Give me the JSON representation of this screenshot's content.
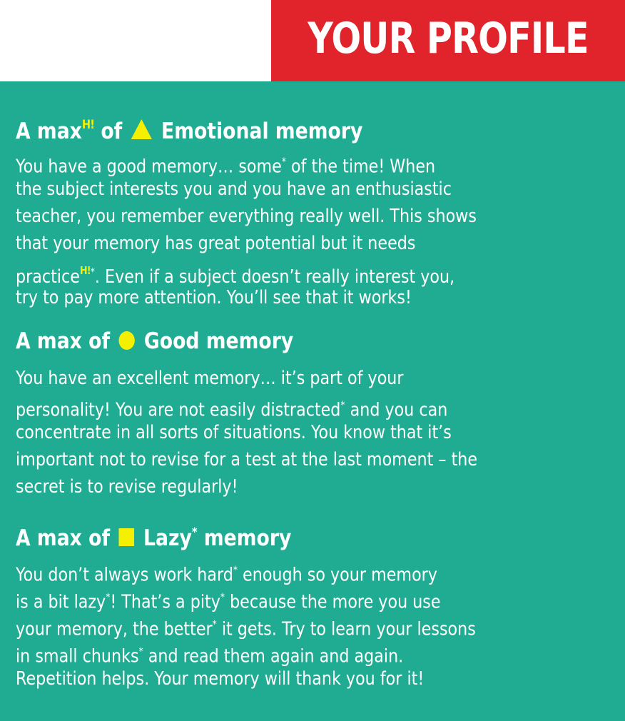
{
  "title": "YOUR PROFILE",
  "sections": [
    {
      "heading_prefix": "A max",
      "heading_sup": "H!",
      "heading_of": "of",
      "heading_text": "Emotional memory",
      "symbol": "triangle-icon",
      "body": {
        "line1": "You have a good memory… some",
        "line1_star": "*",
        "line1_end": " of the time! When",
        "line2": "the subject interests you and you have an enthusiastic",
        "line3": "teacher, you remember everything really well. This shows",
        "line4": "that your memory has great potential but it needs",
        "line5": "practice",
        "line5_sup": "H!",
        "line5_star": "*",
        "line5_end": ". Even if a subject doesn’t really interest you,",
        "line6": "try to pay more attention. You’ll see that it works!"
      }
    },
    {
      "heading_prefix": "A max of",
      "heading_text": "Good memory",
      "symbol": "circle-icon",
      "body": {
        "line1": "You have an excellent memory… it’s part of your",
        "line2": "personality! You are not easily distracted",
        "line2_star": "*",
        "line2_end": " and you can",
        "line3": "concentrate in all sorts of situations. You know that it’s",
        "line4": "important not to revise for a test at the last moment – the",
        "line5": "secret is to revise regularly!"
      }
    },
    {
      "heading_prefix": "A max of",
      "heading_text": "Lazy",
      "heading_star": "*",
      "heading_end": " memory",
      "symbol": "square-icon",
      "body": {
        "line1": "You don’t always work hard",
        "line1_star": "*",
        "line1_end": " enough so your memory",
        "line2": "is a bit lazy",
        "line2_star": "*",
        "line2_mid": "! That’s a pity",
        "line2_star2": "*",
        "line2_end": " because the more you use",
        "line3": "your memory, the better",
        "line3_star": "*",
        "line3_end": " it gets. Try to learn your lessons",
        "line4": "in small chunks",
        "line4_star": "*",
        "line4_end": " and read them again and again.",
        "line5": "Repetition helps. Your memory will thank you for it!"
      }
    }
  ],
  "colors": {
    "title_bg": "#e1242b",
    "panel_bg": "#1fac93",
    "symbol_yellow": "#f4f000",
    "text": "#ffffff"
  }
}
